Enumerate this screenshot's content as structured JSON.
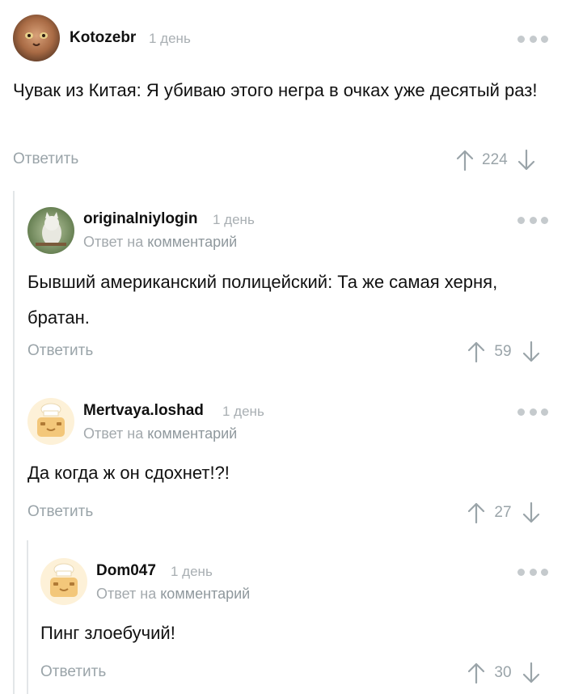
{
  "comments": [
    {
      "username": "Kotozebr",
      "time": "1 день",
      "reply_to_prefix": "",
      "reply_to_link": "",
      "text": "Чувак из Китая: Я убиваю этого негра в очках уже десятый раз!",
      "reply_label": "Ответить",
      "rating": "224",
      "avatar": "cat-avatar"
    },
    {
      "username": "originalniylogin",
      "time": "1 день",
      "reply_to_prefix": "Ответ на",
      "reply_to_link": "комментарий",
      "text": "Бывший американский полицейский: Та же самая херня, братан.",
      "reply_label": "Ответить",
      "rating": "59",
      "avatar": "cat-photo-avatar"
    },
    {
      "username": "Mertvaya.loshad",
      "time": "1 день",
      "reply_to_prefix": "Ответ на",
      "reply_to_link": "комментарий",
      "text": "Да когда ж он сдохнет!?!",
      "reply_label": "Ответить",
      "rating": "27",
      "avatar": "default-chef-avatar"
    },
    {
      "username": "Dom047",
      "time": "1 день",
      "reply_to_prefix": "Ответ на",
      "reply_to_link": "комментарий",
      "text": "Пинг злоебучий!",
      "reply_label": "Ответить",
      "rating": "30",
      "avatar": "default-chef-avatar"
    }
  ],
  "colors": {
    "muted": "#9aa4a9",
    "thread_line": "#e3e6e8",
    "text": "#111111"
  }
}
